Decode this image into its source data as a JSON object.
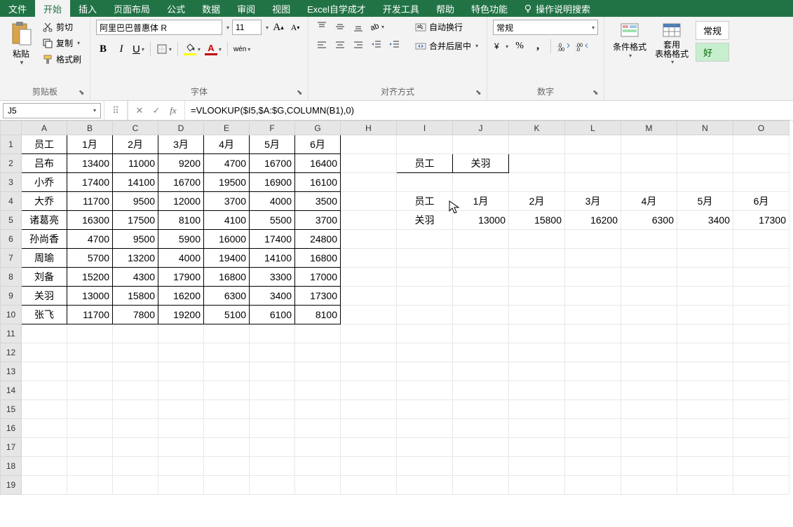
{
  "tabs": {
    "file": "文件",
    "home": "开始",
    "insert": "插入",
    "layout": "页面布局",
    "formula": "公式",
    "data": "数据",
    "review": "审阅",
    "view": "视图",
    "custom1": "Excel自学成才",
    "dev": "开发工具",
    "help": "帮助",
    "special": "特色功能",
    "tell": "操作说明搜索"
  },
  "clipboard": {
    "paste": "粘贴",
    "cut": "剪切",
    "copy": "复制",
    "painter": "格式刷",
    "label": "剪贴板"
  },
  "font": {
    "name": "阿里巴巴普惠体 R",
    "size": "11",
    "label": "字体",
    "wen": "wén"
  },
  "align": {
    "wrap": "自动换行",
    "merge": "合并后居中",
    "label": "对齐方式"
  },
  "number": {
    "format": "常规",
    "label": "数字"
  },
  "styles": {
    "cond": "条件格式",
    "table": "套用\n表格格式",
    "normal": "常规",
    "good": "好"
  },
  "namebox": "J5",
  "formula": "=VLOOKUP($I5,$A:$G,COLUMN(B1),0)",
  "columns": [
    "A",
    "B",
    "C",
    "D",
    "E",
    "F",
    "G",
    "H",
    "I",
    "J",
    "K",
    "L",
    "M",
    "N",
    "O"
  ],
  "main_table": {
    "header": [
      "员工",
      "1月",
      "2月",
      "3月",
      "4月",
      "5月",
      "6月"
    ],
    "rows": [
      [
        "吕布",
        "13400",
        "11000",
        "9200",
        "4700",
        "16700",
        "16400"
      ],
      [
        "小乔",
        "17400",
        "14100",
        "16700",
        "19500",
        "16900",
        "16100"
      ],
      [
        "大乔",
        "11700",
        "9500",
        "12000",
        "3700",
        "4000",
        "3500"
      ],
      [
        "诸葛亮",
        "16300",
        "17500",
        "8100",
        "4100",
        "5500",
        "3700"
      ],
      [
        "孙尚香",
        "4700",
        "9500",
        "5900",
        "16000",
        "17400",
        "24800"
      ],
      [
        "周瑜",
        "5700",
        "13200",
        "4000",
        "19400",
        "14100",
        "16800"
      ],
      [
        "刘备",
        "15200",
        "4300",
        "17900",
        "16800",
        "3300",
        "17000"
      ],
      [
        "关羽",
        "13000",
        "15800",
        "16200",
        "6300",
        "3400",
        "17300"
      ],
      [
        "张飞",
        "11700",
        "7800",
        "19200",
        "5100",
        "6100",
        "8100"
      ]
    ]
  },
  "lookup": {
    "label": "员工",
    "value": "关羽",
    "header": [
      "员工",
      "1月",
      "2月",
      "3月",
      "4月",
      "5月",
      "6月"
    ],
    "result": [
      "关羽",
      "13000",
      "15800",
      "16200",
      "6300",
      "3400",
      "17300"
    ]
  }
}
